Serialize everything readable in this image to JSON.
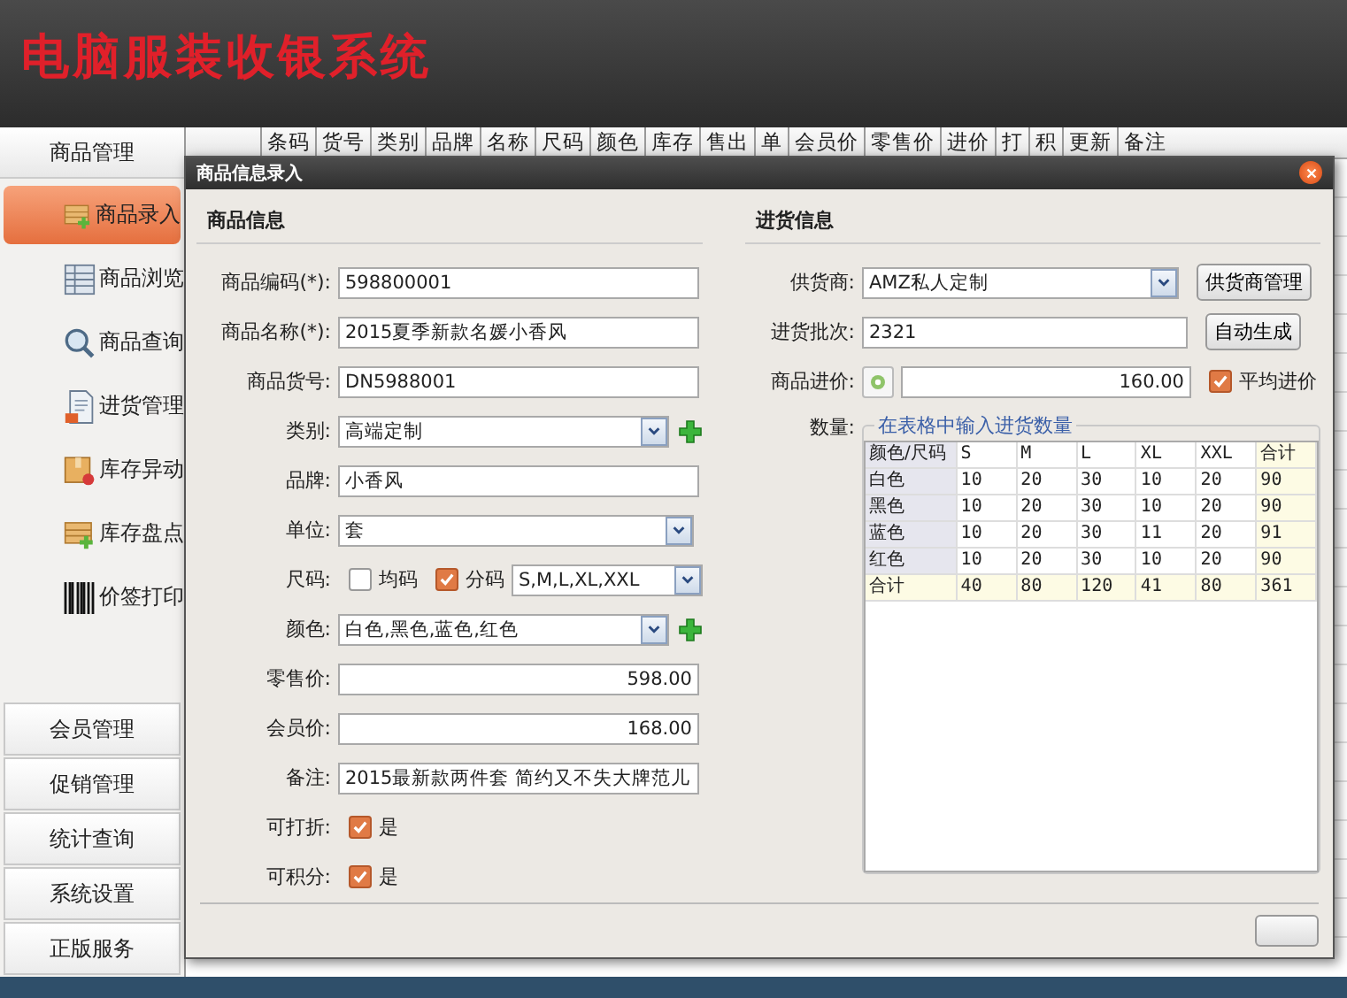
{
  "app_title": "电脑服装收银系统",
  "sidebar": {
    "header": "商品管理",
    "items": [
      {
        "label": "商品录入",
        "kind": "add",
        "selected": true
      },
      {
        "label": "商品浏览",
        "kind": "browse",
        "selected": false
      },
      {
        "label": "商品查询",
        "kind": "query",
        "selected": false
      },
      {
        "label": "进货管理",
        "kind": "purchase",
        "selected": false
      },
      {
        "label": "库存异动",
        "kind": "stock",
        "selected": false
      },
      {
        "label": "库存盘点",
        "kind": "add",
        "selected": false
      },
      {
        "label": "价签打印",
        "kind": "print",
        "selected": false
      }
    ],
    "bottom_items": [
      "会员管理",
      "促销管理",
      "统计查询",
      "系统设置",
      "正版服务"
    ]
  },
  "table": {
    "columns": [
      "条码",
      "货号",
      "类别",
      "品牌",
      "名称",
      "尺码",
      "颜色",
      "库存",
      "售出",
      "单",
      "会员价",
      "零售价",
      "进价",
      "打",
      "积",
      "更新",
      "备注"
    ]
  },
  "dialog": {
    "title": "商品信息录入",
    "left": {
      "heading": "商品信息",
      "fields": [
        {
          "kind": "text",
          "label": "商品编码(*):",
          "value": "598800001"
        },
        {
          "kind": "text",
          "label": "商品名称(*):",
          "value": "2015夏季新款名媛小香风"
        },
        {
          "kind": "text",
          "label": "商品货号:",
          "value": "DN5988001"
        },
        {
          "kind": "select-add",
          "label": "类别:",
          "value": "高端定制"
        },
        {
          "kind": "text",
          "label": "品牌:",
          "value": "小香风"
        },
        {
          "kind": "select",
          "label": "单位:",
          "value": "套"
        },
        {
          "kind": "sizes",
          "label": "尺码:",
          "options": [
            {
              "label": "均码",
              "checked": false
            },
            {
              "label": "分码",
              "checked": true
            }
          ],
          "value": "S,M,L,XL,XXL"
        },
        {
          "kind": "select-add",
          "label": "颜色:",
          "value": "白色,黑色,蓝色,红色"
        },
        {
          "kind": "number",
          "label": "零售价:",
          "value": "598.00"
        },
        {
          "kind": "number",
          "label": "会员价:",
          "value": "168.00"
        },
        {
          "kind": "text",
          "label": "备注:",
          "value": "2015最新款两件套 简约又不失大牌范儿"
        },
        {
          "kind": "check",
          "label": "可打折:",
          "option": "是",
          "checked": true
        },
        {
          "kind": "check",
          "label": "可积分:",
          "option": "是",
          "checked": true
        }
      ]
    },
    "right": {
      "heading": "进货信息",
      "supplier": {
        "label": "供货商:",
        "value": "AMZ私人定制",
        "button": "供货商管理"
      },
      "batch": {
        "label": "进货批次:",
        "value": "2321",
        "button": "自动生成"
      },
      "cost": {
        "label": "商品进价:",
        "value": "160.00",
        "option": "平均进价",
        "checked": true
      },
      "quantity": {
        "label": "数量:",
        "legend": "在表格中输入进货数量",
        "header": [
          "颜色/尺码",
          "S",
          "M",
          "L",
          "XL",
          "XXL",
          "合计"
        ],
        "rows": [
          {
            "name": "白色",
            "values": [
              "10",
              "20",
              "30",
              "10",
              "20"
            ],
            "total": "90"
          },
          {
            "name": "黑色",
            "values": [
              "10",
              "20",
              "30",
              "10",
              "20"
            ],
            "total": "90"
          },
          {
            "name": "蓝色",
            "values": [
              "10",
              "20",
              "30",
              "11",
              "20"
            ],
            "total": "91"
          },
          {
            "name": "红色",
            "values": [
              "10",
              "20",
              "30",
              "10",
              "20"
            ],
            "total": "90"
          }
        ],
        "sum": {
          "name": "合计",
          "values": [
            "40",
            "80",
            "120",
            "41",
            "80"
          ],
          "total": "361"
        }
      }
    }
  }
}
